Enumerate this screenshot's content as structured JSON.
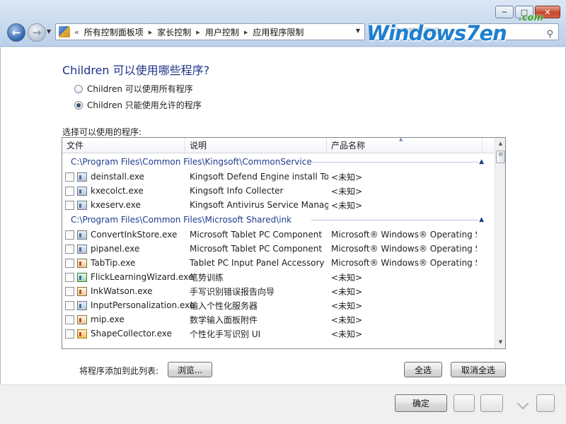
{
  "nav": {
    "breadcrumbs": [
      "所有控制面板项",
      "家长控制",
      "用户控制",
      "应用程序限制"
    ],
    "search_placeholder": "搜索控制面板"
  },
  "watermark": {
    "main": "Windows7en",
    "sub": ".com"
  },
  "window": {
    "minimize": "─",
    "maximize": "□",
    "close": "✕"
  },
  "content": {
    "heading": "Children 可以使用哪些程序?",
    "radio_all": "Children 可以使用所有程序",
    "radio_allowed": "Children 只能使用允许的程序",
    "list_label": "选择可以使用的程序:"
  },
  "list": {
    "columns": [
      "文件",
      "说明",
      "产品名称"
    ],
    "groups": [
      {
        "path": "C:\\Program Files\\Common Files\\Kingsoft\\CommonService",
        "rows": [
          {
            "file": "deinstall.exe",
            "desc": "Kingsoft Defend Engine install Tool",
            "product": "<未知>",
            "icon": "exe-icon"
          },
          {
            "file": "kxecolct.exe",
            "desc": "Kingsoft Info Collecter",
            "product": "<未知>",
            "icon": "exe-icon"
          },
          {
            "file": "kxeserv.exe",
            "desc": "Kingsoft Antivirus Service Manager",
            "product": "<未知>",
            "icon": "exe-icon"
          }
        ]
      },
      {
        "path": "C:\\Program Files\\Common Files\\Microsoft Shared\\ink",
        "rows": [
          {
            "file": "ConvertInkStore.exe",
            "desc": "Microsoft Tablet PC Component",
            "product": "Microsoft® Windows® Operating Sy...",
            "icon": "exe-icon"
          },
          {
            "file": "pipanel.exe",
            "desc": "Microsoft Tablet PC Component",
            "product": "Microsoft® Windows® Operating Sy...",
            "icon": "exe-icon"
          },
          {
            "file": "TabTip.exe",
            "desc": "Tablet PC Input Panel Accessory",
            "product": "Microsoft® Windows® Operating Sy...",
            "icon": "pen-icon"
          },
          {
            "file": "FlickLearningWizard.exe",
            "desc": "笔势训练",
            "product": "<未知>",
            "icon": "puzzle-icon"
          },
          {
            "file": "InkWatson.exe",
            "desc": "手写识别错误报告向导",
            "product": "<未知>",
            "icon": "pen-icon"
          },
          {
            "file": "InputPersonalization.exe",
            "desc": "输入个性化服务器",
            "product": "<未知>",
            "icon": "exe-icon"
          },
          {
            "file": "mip.exe",
            "desc": "数学输入面板附件",
            "product": "<未知>",
            "icon": "pen-icon"
          },
          {
            "file": "ShapeCollector.exe",
            "desc": "个性化手写识别 UI",
            "product": "<未知>",
            "icon": "shape-icon"
          }
        ]
      }
    ]
  },
  "actions": {
    "add_label": "将程序添加到此列表:",
    "browse": "浏览...",
    "select_all": "全选",
    "deselect_all": "取消全选"
  },
  "footer": {
    "ok": "确定"
  }
}
